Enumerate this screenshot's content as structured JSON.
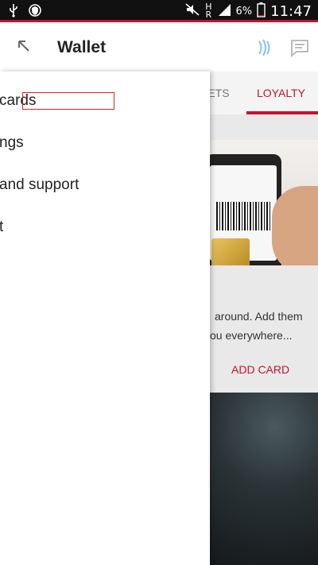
{
  "status_bar": {
    "battery_percent": "6%",
    "time": "11:47",
    "network": "H",
    "network_r": "R"
  },
  "app_bar": {
    "title": "Wallet"
  },
  "drawer": {
    "items": [
      {
        "label": "cards"
      },
      {
        "label": "ngs"
      },
      {
        "label": "and support"
      },
      {
        "label": "t"
      }
    ]
  },
  "tabs": {
    "tickets_label": "KETS",
    "loyalty_label": "LOYALTY"
  },
  "content": {
    "description_line1": "around. Add them",
    "description_line2": "ou everywhere...",
    "add_card_label": "ADD CARD"
  },
  "colors": {
    "accent": "#c8102e"
  }
}
